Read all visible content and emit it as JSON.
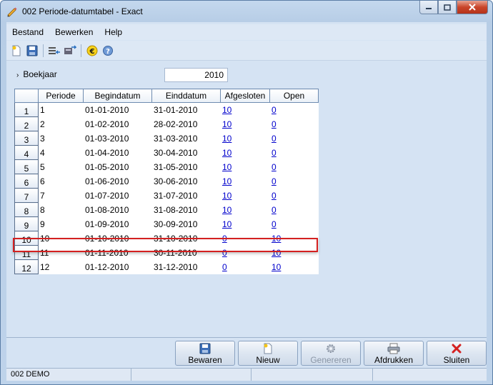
{
  "window": {
    "title": "002 Periode-datumtabel - Exact"
  },
  "menu": {
    "items": [
      "Bestand",
      "Bewerken",
      "Help"
    ]
  },
  "toolbar": {
    "icons": [
      "new-icon",
      "save-icon",
      "import-icon",
      "export-icon",
      "euro-icon",
      "help-icon"
    ]
  },
  "boekjaar": {
    "label": "Boekjaar",
    "value": "2010"
  },
  "table": {
    "columns": [
      "Periode",
      "Begindatum",
      "Einddatum",
      "Afgesloten",
      "Open"
    ],
    "rows": [
      {
        "rownum": "1",
        "periode": "1",
        "begin": "01-01-2010",
        "eind": "31-01-2010",
        "afgesloten": "10",
        "open": "0"
      },
      {
        "rownum": "2",
        "periode": "2",
        "begin": "01-02-2010",
        "eind": "28-02-2010",
        "afgesloten": "10",
        "open": "0"
      },
      {
        "rownum": "3",
        "periode": "3",
        "begin": "01-03-2010",
        "eind": "31-03-2010",
        "afgesloten": "10",
        "open": "0"
      },
      {
        "rownum": "4",
        "periode": "4",
        "begin": "01-04-2010",
        "eind": "30-04-2010",
        "afgesloten": "10",
        "open": "0"
      },
      {
        "rownum": "5",
        "periode": "5",
        "begin": "01-05-2010",
        "eind": "31-05-2010",
        "afgesloten": "10",
        "open": "0"
      },
      {
        "rownum": "6",
        "periode": "6",
        "begin": "01-06-2010",
        "eind": "30-06-2010",
        "afgesloten": "10",
        "open": "0"
      },
      {
        "rownum": "7",
        "periode": "7",
        "begin": "01-07-2010",
        "eind": "31-07-2010",
        "afgesloten": "10",
        "open": "0"
      },
      {
        "rownum": "8",
        "periode": "8",
        "begin": "01-08-2010",
        "eind": "31-08-2010",
        "afgesloten": "10",
        "open": "0"
      },
      {
        "rownum": "9",
        "periode": "9",
        "begin": "01-09-2010",
        "eind": "30-09-2010",
        "afgesloten": "10",
        "open": "0"
      },
      {
        "rownum": "10",
        "periode": "10",
        "begin": "01-10-2010",
        "eind": "31-10-2010",
        "afgesloten": "0",
        "open": "10"
      },
      {
        "rownum": "11",
        "periode": "11",
        "begin": "01-11-2010",
        "eind": "30-11-2010",
        "afgesloten": "0",
        "open": "10"
      },
      {
        "rownum": "12",
        "periode": "12",
        "begin": "01-12-2010",
        "eind": "31-12-2010",
        "afgesloten": "0",
        "open": "10"
      }
    ]
  },
  "buttons": {
    "bewaren": "Bewaren",
    "nieuw": "Nieuw",
    "genereren": "Genereren",
    "afdrukken": "Afdrukken",
    "sluiten": "Sluiten"
  },
  "status": {
    "company": "002 DEMO"
  },
  "colors": {
    "highlight": "#d42020",
    "link": "#0000cc",
    "close_red": "#c9452a"
  }
}
